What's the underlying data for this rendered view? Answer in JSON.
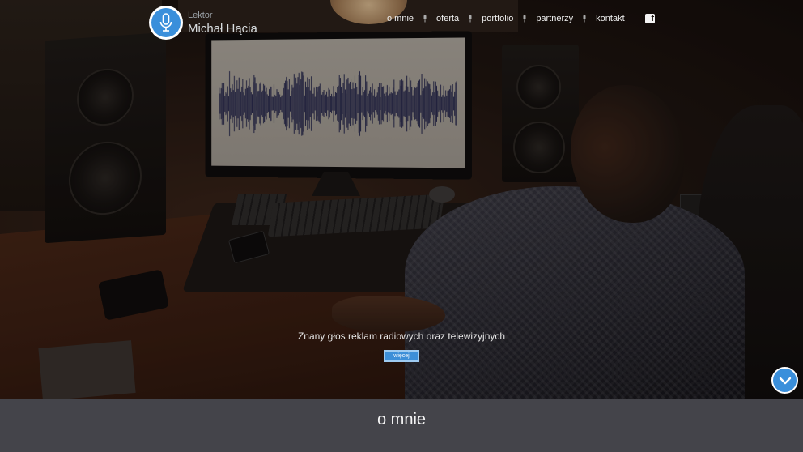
{
  "header": {
    "logo": {
      "subtitle": "Lektor",
      "name": "Michał Hącia",
      "icon": "microphone-icon"
    },
    "nav": [
      {
        "label": "o mnie"
      },
      {
        "label": "oferta"
      },
      {
        "label": "portfolio"
      },
      {
        "label": "partnerzy"
      },
      {
        "label": "kontakt"
      }
    ],
    "nav_separator_icon": "microphone-icon",
    "social": {
      "icon": "facebook-icon",
      "glyph": "f"
    }
  },
  "hero": {
    "tagline": "Znany głos reklam radiowych oraz telewizyjnych",
    "button_label": "więcej",
    "scroll_icon": "chevron-down-icon"
  },
  "section": {
    "title": "o mnie"
  },
  "colors": {
    "accent": "#3a8fdb",
    "section_bg": "#44444a",
    "text_light": "#f0f0f0"
  }
}
